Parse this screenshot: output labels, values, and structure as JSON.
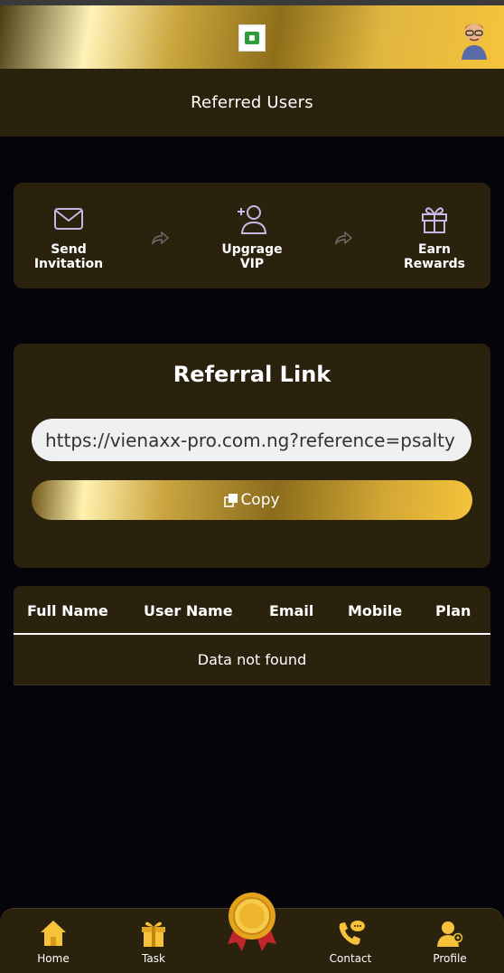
{
  "header": {
    "logo_icon": "app-logo",
    "avatar_icon": "user-avatar"
  },
  "page": {
    "title": "Referred Users"
  },
  "steps": [
    {
      "icon": "envelope-icon",
      "line1": "Send",
      "line2": "Invitation"
    },
    {
      "icon": "add-user-icon",
      "line1": "Upgrage",
      "line2": "VIP"
    },
    {
      "icon": "gift-icon",
      "line1": "Earn",
      "line2": "Rewards"
    }
  ],
  "referral": {
    "heading": "Referral Link",
    "link": "https://vienaxx-pro.com.ng?reference=psalty",
    "copy_label": "Copy"
  },
  "table": {
    "columns": [
      "Full Name",
      "User Name",
      "Email",
      "Mobile",
      "Plan"
    ],
    "empty_message": "Data not found"
  },
  "nav": {
    "items": [
      {
        "label": "Home",
        "icon": "home-icon"
      },
      {
        "label": "Task",
        "icon": "gift-box-icon"
      },
      {
        "label": "",
        "icon": "medal-icon"
      },
      {
        "label": "Contact",
        "icon": "phone-chat-icon"
      },
      {
        "label": "Profile",
        "icon": "profile-icon"
      }
    ]
  },
  "colors": {
    "background": "#04040a",
    "panel": "#2b220e",
    "gold": "#f6c33b"
  }
}
